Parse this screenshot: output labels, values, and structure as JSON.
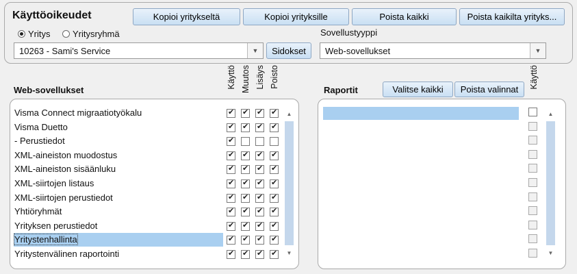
{
  "header": {
    "title": "Käyttöoikeudet",
    "copy_from_company": "Kopioi yritykseltä",
    "copy_to_companies": "Kopioi yrityksille",
    "remove_all": "Poista kaikki",
    "remove_all_from_companies": "Poista kaikilta yrityks..."
  },
  "scope": {
    "option_company": "Yritys",
    "option_group": "Yritysryhmä",
    "selected": "Yritys"
  },
  "company_select": {
    "value": "10263 - Sami's Service"
  },
  "links_button": "Sidokset",
  "app_type": {
    "label": "Sovellustyyppi",
    "value": "Web-sovellukset"
  },
  "web_apps": {
    "title": "Web-sovellukset",
    "columns": [
      "Käyttö",
      "Muutos",
      "Lisäys",
      "Poisto"
    ],
    "rows": [
      {
        "label": "Visma Connect migraatiotyökalu",
        "perms": [
          true,
          true,
          true,
          true
        ]
      },
      {
        "label": "Visma Duetto",
        "perms": [
          true,
          true,
          true,
          true
        ]
      },
      {
        "label": "- Perustiedot",
        "perms": [
          true,
          false,
          false,
          false
        ]
      },
      {
        "label": "XML-aineiston muodostus",
        "perms": [
          true,
          true,
          true,
          true
        ]
      },
      {
        "label": "XML-aineiston sisäänluku",
        "perms": [
          true,
          true,
          true,
          true
        ]
      },
      {
        "label": "XML-siirtojen listaus",
        "perms": [
          true,
          true,
          true,
          true
        ]
      },
      {
        "label": "XML-siirtojen perustiedot",
        "perms": [
          true,
          true,
          true,
          true
        ]
      },
      {
        "label": "Yhtiöryhmät",
        "perms": [
          true,
          true,
          true,
          true
        ]
      },
      {
        "label": "Yrityksen perustiedot",
        "perms": [
          true,
          true,
          true,
          true
        ]
      },
      {
        "label": "Yritystenhallinta",
        "perms": [
          true,
          true,
          true,
          true
        ],
        "selected": true
      },
      {
        "label": "Yritystenvälinen raportointi",
        "perms": [
          true,
          true,
          true,
          true
        ]
      }
    ]
  },
  "reports": {
    "title": "Raportit",
    "select_all": "Valitse kaikki",
    "clear_selections": "Poista valinnat",
    "column": "Käyttö",
    "row_count": 11
  }
}
